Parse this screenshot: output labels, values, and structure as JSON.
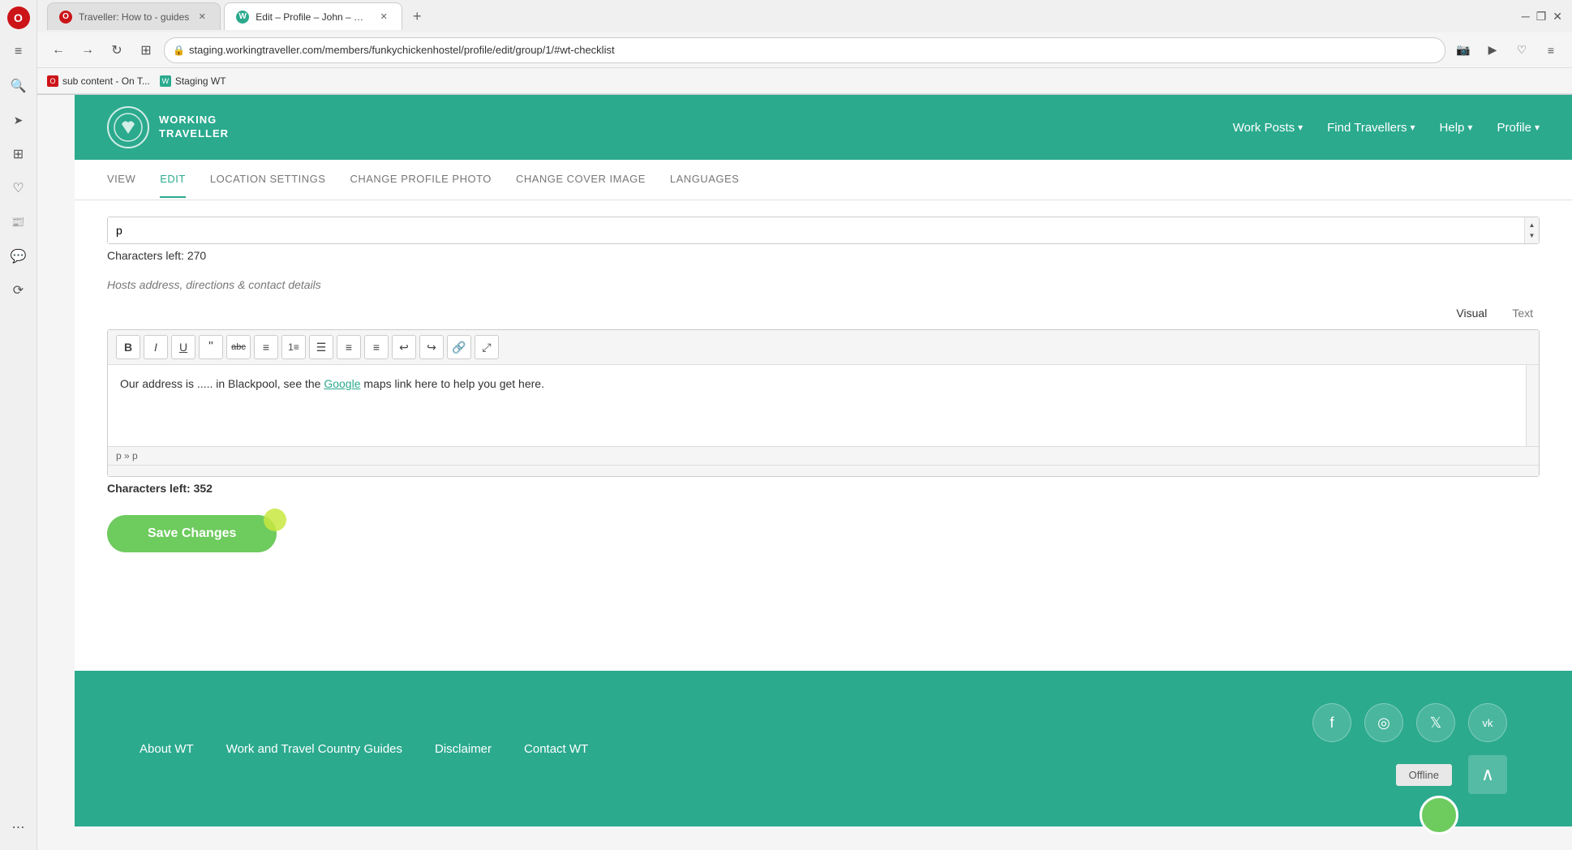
{
  "browser": {
    "tabs": [
      {
        "id": "tab1",
        "favicon_color": "#cc1418",
        "favicon_letter": "O",
        "label": "Traveller: How to - guides",
        "active": false
      },
      {
        "id": "tab2",
        "favicon_color": "#2baa8e",
        "favicon_letter": "W",
        "label": "Edit – Profile – John – Wor...",
        "active": true
      }
    ],
    "new_tab_label": "+",
    "address": "staging.workingtraveller.com/members/funkychickenhostel/profile/edit/group/1/#wt-checklist",
    "bookmarks": [
      {
        "label": "sub content - On T...",
        "favicon_color": "#cc1418",
        "favicon_letter": "O"
      },
      {
        "label": "Staging WT",
        "favicon_color": "#2baa8e",
        "favicon_letter": "W"
      }
    ]
  },
  "opera_sidebar": {
    "icons": [
      {
        "name": "opera-logo",
        "symbol": "O",
        "color": "#cc1418"
      },
      {
        "name": "settings-icon",
        "symbol": "≡",
        "label": "Menu"
      },
      {
        "name": "search-icon",
        "symbol": "🔍",
        "label": "Search"
      },
      {
        "name": "send-icon",
        "symbol": "➤",
        "label": "Send"
      },
      {
        "name": "apps-icon",
        "symbol": "⊞",
        "label": "Apps"
      },
      {
        "name": "heart-icon",
        "symbol": "♡",
        "label": "Wishlist"
      },
      {
        "name": "news-icon",
        "symbol": "📰",
        "label": "News"
      },
      {
        "name": "messenger-icon",
        "symbol": "💬",
        "label": "Messenger"
      },
      {
        "name": "history-icon",
        "symbol": "⟳",
        "label": "History"
      },
      {
        "name": "more-icon",
        "symbol": "•••",
        "label": "More"
      }
    ]
  },
  "site": {
    "logo_text": "WORKING\nTRAVELLER",
    "logo_symbol": "✦",
    "nav": [
      {
        "label": "Work Posts",
        "has_dropdown": true
      },
      {
        "label": "Find Travellers",
        "has_dropdown": true
      },
      {
        "label": "Help",
        "has_dropdown": true
      },
      {
        "label": "Profile",
        "has_dropdown": true
      }
    ]
  },
  "sub_nav": {
    "items": [
      {
        "label": "VIEW",
        "active": false
      },
      {
        "label": "EDIT",
        "active": true
      },
      {
        "label": "LOCATION SETTINGS",
        "active": false
      },
      {
        "label": "CHANGE PROFILE PHOTO",
        "active": false
      },
      {
        "label": "CHANGE COVER IMAGE",
        "active": false
      },
      {
        "label": "LANGUAGES",
        "active": false
      }
    ]
  },
  "editor": {
    "top_input_value": "p",
    "top_chars_label": "Characters left:",
    "top_chars_value": "270",
    "field_hint": "Hosts address, directions & contact details",
    "mode_visual": "Visual",
    "mode_text": "Text",
    "toolbar_buttons": [
      {
        "name": "bold-btn",
        "symbol": "B",
        "title": "Bold"
      },
      {
        "name": "italic-btn",
        "symbol": "I",
        "title": "Italic"
      },
      {
        "name": "underline-btn",
        "symbol": "U",
        "title": "Underline"
      },
      {
        "name": "blockquote-btn",
        "symbol": "❝",
        "title": "Blockquote"
      },
      {
        "name": "strikethrough-btn",
        "symbol": "abc̶",
        "title": "Strikethrough"
      },
      {
        "name": "bullet-list-btn",
        "symbol": "≡",
        "title": "Bullet List"
      },
      {
        "name": "numbered-list-btn",
        "symbol": "1≡",
        "title": "Numbered List"
      },
      {
        "name": "align-left-btn",
        "symbol": "☰",
        "title": "Align Left"
      },
      {
        "name": "align-center-btn",
        "symbol": "≡",
        "title": "Align Center"
      },
      {
        "name": "align-right-btn",
        "symbol": "≡",
        "title": "Align Right"
      },
      {
        "name": "undo-btn",
        "symbol": "↩",
        "title": "Undo"
      },
      {
        "name": "redo-btn",
        "symbol": "↪",
        "title": "Redo"
      },
      {
        "name": "link-btn",
        "symbol": "🔗",
        "title": "Insert Link"
      },
      {
        "name": "fullscreen-btn",
        "symbol": "⤢",
        "title": "Fullscreen"
      }
    ],
    "content_text": "Our address is ..... in Blackpool, see the Google maps link here to help you get here.",
    "content_link_text": "Google",
    "footer_text": "p » p",
    "bottom_chars_label": "Characters left:",
    "bottom_chars_value": "352",
    "save_button_label": "Save Changes"
  },
  "footer": {
    "links": [
      {
        "label": "About WT"
      },
      {
        "label": "Work and Travel Country Guides"
      },
      {
        "label": "Disclaimer"
      },
      {
        "label": "Contact WT"
      }
    ],
    "socials": [
      {
        "name": "facebook-icon",
        "symbol": "f"
      },
      {
        "name": "instagram-icon",
        "symbol": "◎"
      },
      {
        "name": "twitter-icon",
        "symbol": "𝕏"
      },
      {
        "name": "vk-icon",
        "symbol": "vk"
      }
    ],
    "offline_label": "Offline",
    "back_to_top_symbol": "∧"
  }
}
